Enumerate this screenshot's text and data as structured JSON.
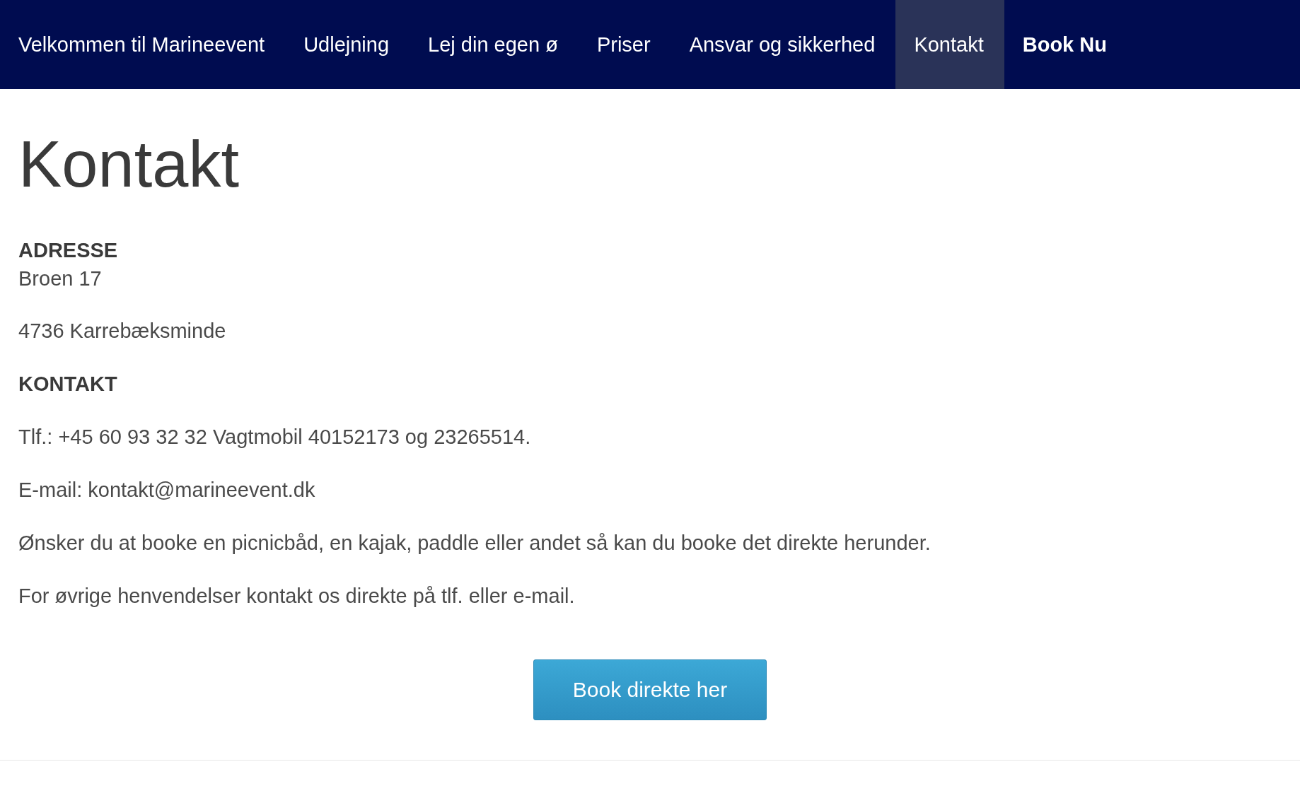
{
  "nav": {
    "items": [
      {
        "label": "Velkommen til Marineevent",
        "kind": "link",
        "selected": false
      },
      {
        "label": "Udlejning",
        "kind": "link",
        "selected": false
      },
      {
        "label": "Lej din egen ø",
        "kind": "link",
        "selected": false
      },
      {
        "label": "Priser",
        "kind": "link",
        "selected": false
      },
      {
        "label": "Ansvar og sikkerhed",
        "kind": "link",
        "selected": false
      },
      {
        "label": "Kontakt",
        "kind": "link",
        "selected": true
      },
      {
        "label": "Book Nu",
        "kind": "cta",
        "selected": false
      }
    ]
  },
  "page_title": "Kontakt",
  "content": [
    {
      "kind": "heading",
      "text": "ADRESSE"
    },
    {
      "kind": "line",
      "text": "Broen 17"
    },
    {
      "kind": "paragraph",
      "text": "4736 Karrebæksminde"
    },
    {
      "kind": "heading",
      "text": "KONTAKT"
    },
    {
      "kind": "paragraph",
      "text": "Tlf.: +45 60 93 32 32 Vagtmobil 40152173 og 23265514."
    },
    {
      "kind": "paragraph",
      "text": "E-mail: kontakt@marineevent.dk"
    },
    {
      "kind": "paragraph",
      "text": "Ønsker du at booke en picnicbåd, en kajak, paddle eller andet så kan du booke det direkte herunder."
    },
    {
      "kind": "paragraph",
      "text": "For øvrige henvendelser kontakt os direkte på tlf. eller e-mail."
    }
  ],
  "book_button": "Book direkte her"
}
